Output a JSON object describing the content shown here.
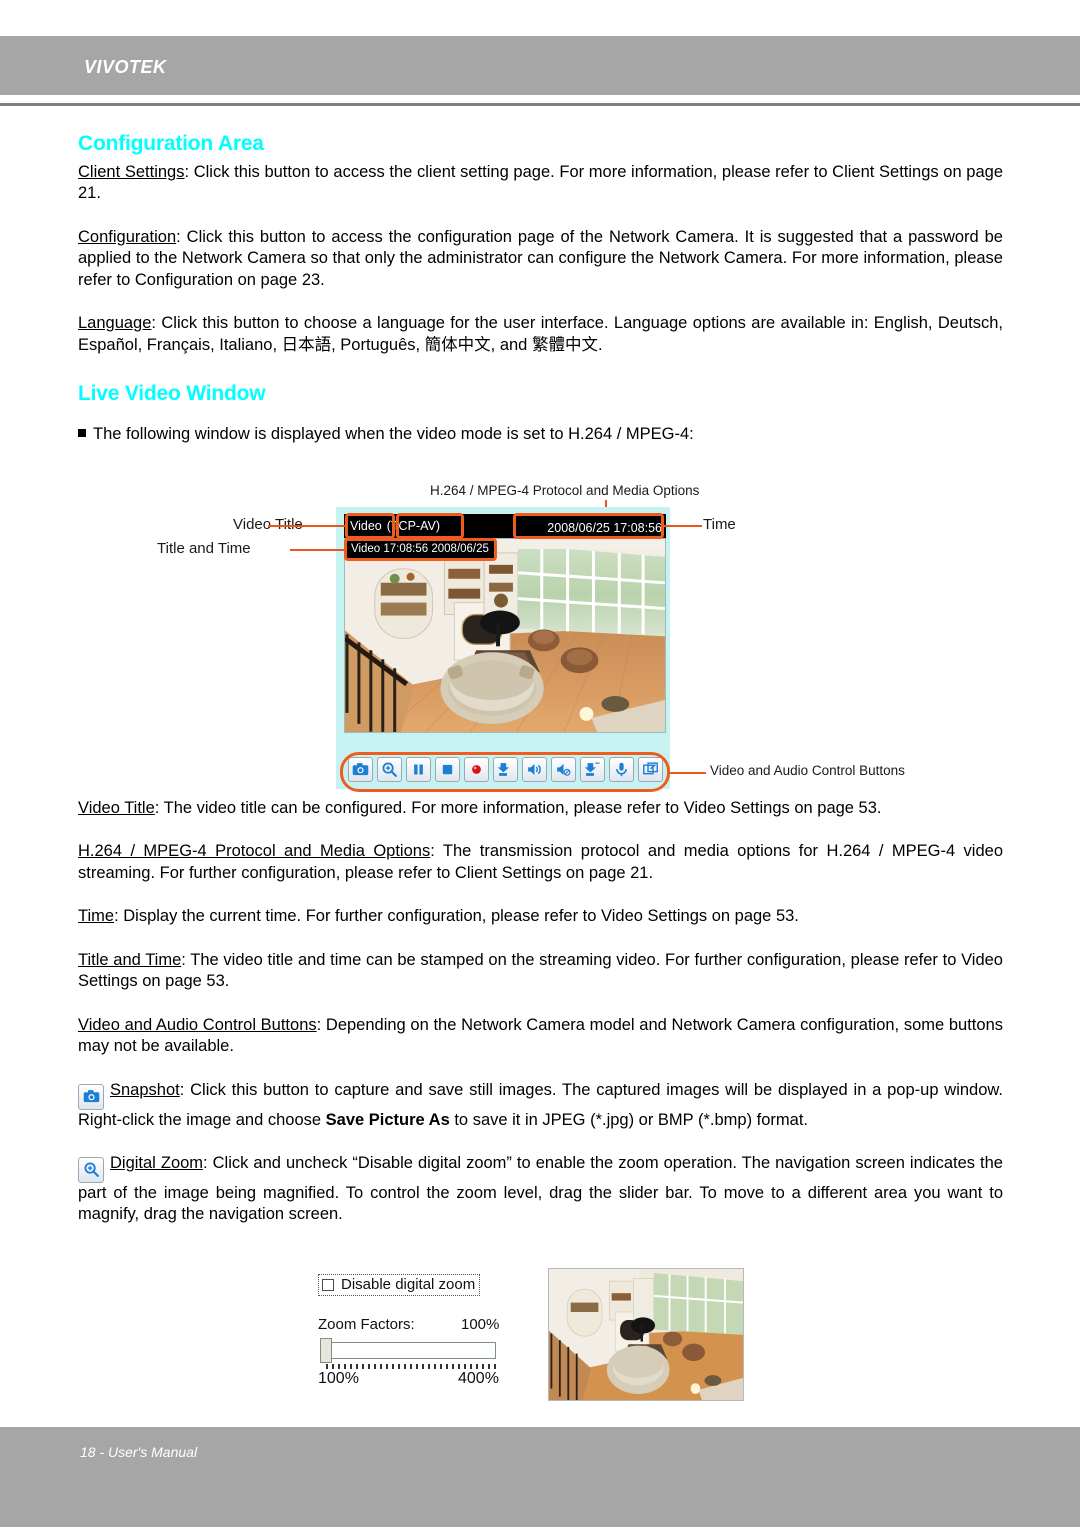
{
  "header": {
    "logo": "VIVOTEK"
  },
  "footer": {
    "page_label": "18 - User's Manual"
  },
  "sections": {
    "config_area": {
      "heading": "Configuration Area",
      "p1_term": "Client Settings",
      "p1_body": ": Click this button to access the client setting page. For more information, please refer to Client Settings on page 21.",
      "p2_term": "Configuration",
      "p2_body": ": Click this button to access the configuration page of the Network Camera. It is suggested that a password be applied to the Network Camera so that only the administrator can configure the Network Camera. For more information, please refer to Configuration on page 23.",
      "p3_term": "Language",
      "p3_body": ": Click this button to choose a language for the user interface. Language options are available in: English, Deutsch, Español, Français, Italiano, 日本語, Português, 簡体中文, and 繁體中文."
    },
    "live_video": {
      "heading": "Live Video Window",
      "bullet": "The following window is displayed when the video mode is set to H.264 / MPEG-4:",
      "p_videotitle_term": "Video Title",
      "p_videotitle_body": ": The video title can be configured. For more information, please refer to Video Settings on page 53.",
      "p_protocol_term": "H.264 / MPEG-4 Protocol and Media Options",
      "p_protocol_body": ": The transmission protocol and media options for H.264 / MPEG-4 video streaming. For further configuration, please refer to Client Settings on page 21.",
      "p_time_term": "Time",
      "p_time_body": ": Display the current time. For further configuration, please refer to Video Settings on page 53.",
      "p_titletime_term": "Title and Time",
      "p_titletime_body": ": The video title and time can be stamped on the streaming video. For further configuration, please refer to Video Settings on page 53.",
      "p_controls_term": "Video and Audio Control Buttons",
      "p_controls_body": ": Depending on the Network Camera model and Network Camera configuration, some buttons may not be available.",
      "p_snapshot_term": "Snapshot",
      "p_snapshot_body_1": ": Click this button to capture and save still images. The captured images will be displayed in a pop-up window. Right-click the image and choose ",
      "p_snapshot_bold": "Save Picture As",
      "p_snapshot_body_2": " to save it in JPEG (*.jpg) or BMP (*.bmp) format.",
      "p_zoom_term": "Digital Zoom",
      "p_zoom_body": ": Click and uncheck “Disable digital zoom” to enable the zoom operation. The navigation screen indicates the part of the image being magnified. To control the zoom level, drag the slider bar. To move to a different area you want to magnify, drag the navigation screen."
    }
  },
  "figure_live_window": {
    "callout_top": "H.264 / MPEG-4 Protocol and Media Options",
    "callout_video_title": "Video Title",
    "callout_title_and_time": "Title and Time",
    "callout_time": "Time",
    "callout_controls": "Video and Audio Control Buttons",
    "titlebar_title": "Video",
    "titlebar_protocol": "(TCP-AV)",
    "titlebar_time": "2008/06/25 17:08:56",
    "stamp_overlay": "Video 17:08:56  2008/06/25",
    "buttons": [
      {
        "name": "snapshot-button",
        "icon": "camera-icon"
      },
      {
        "name": "digital-zoom-button",
        "icon": "magnifier-plus-icon"
      },
      {
        "name": "pause-button",
        "icon": "pause-icon"
      },
      {
        "name": "stop-button",
        "icon": "stop-icon"
      },
      {
        "name": "record-button",
        "icon": "record-icon"
      },
      {
        "name": "save-video-button",
        "icon": "video-save-icon"
      },
      {
        "name": "volume-button",
        "icon": "speaker-icon"
      },
      {
        "name": "mute-button",
        "icon": "speaker-mute-icon"
      },
      {
        "name": "save-audio-button",
        "icon": "audio-save-icon"
      },
      {
        "name": "talk-button",
        "icon": "microphone-icon"
      },
      {
        "name": "fullscreen-button",
        "icon": "fullscreen-icon"
      }
    ]
  },
  "figure_digital_zoom": {
    "checkbox_label": "Disable digital zoom",
    "zoom_factors_label": "Zoom Factors:",
    "zoom_factors_value": "100%",
    "scale_min": "100%",
    "scale_max": "400%"
  },
  "colors": {
    "heading_cyan": "#00ffff",
    "band_gray": "#a6a6a6",
    "highlight_orange": "#ef5c1e",
    "video_panel_cyan": "#c6f2f2"
  }
}
